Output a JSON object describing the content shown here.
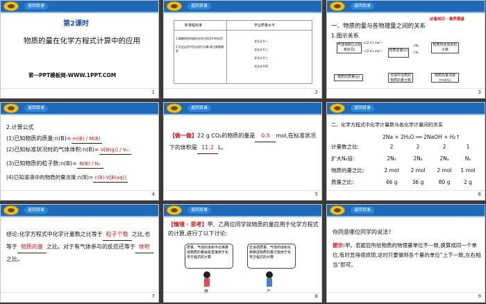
{
  "common": {
    "back_label": "返回目录"
  },
  "s1": {
    "lesson": "第2课时",
    "title": "物质的量在化学方程式计算中的应用",
    "site": "第一PPT模板网-WWW.1PPT.COM",
    "num": "1"
  },
  "s2": {
    "col1": "新课程标准",
    "col2": "学业质量水平",
    "req1": "1.掌握物质的量在化学方程式中的应用",
    "req2": "2.学会运用守恒法进行计算,建立解题模型",
    "levels": [
      "学业水平一",
      "学业水平二",
      "学业水平三",
      "学业水平四"
    ],
    "num": "2"
  },
  "s3": {
    "banner": "必备知识 · 素养奠基",
    "h1": "一、物质的量与各物理量之间的关系",
    "h2": "1.图示关系",
    "center": "物质的量(n)",
    "gas": "气体体积(L)(标准状况)",
    "particles": "物质所含有的粒子数",
    "mass": "物质的质量(g)",
    "conc": "物质的量浓度(mol/L)",
    "solute": "溶液中溶质的物质的量分数",
    "label_vm1": "×22.4 L·mol⁻¹",
    "label_vm2": "÷22.4 L·mol⁻¹",
    "label_na1": "×Nₐ",
    "label_na2": "÷Nₐ",
    "num": "3"
  },
  "s4": {
    "h": "2.计算公式",
    "l1": "(1)已知物质的质量:n(B)=",
    "l1a": "m(B) / M(B)",
    "l2": "(2)已知标准状况时的气体体积:n(B)=",
    "l2a": "V[B(g)] / Vₘ",
    "l3": "(3)已知物质的粒子数:n(B)=",
    "l3a": "N(B) / Nₐ",
    "l4": "(4)已知溶液中的物质的量浓度:n(B)=",
    "l4a": "c(B)·V[B(aq)]",
    "num": "4"
  },
  "s5": {
    "tag": "【做一做】",
    "t1": "22 g CO₂的物质的量是",
    "a1": "0.5",
    "t2": "mol,在标准状况下的体积是",
    "a2": "11.2",
    "t3": "L。",
    "num": "5"
  },
  "s6": {
    "h": "二、化学方程式中化学计量数与各化学计量间的关系",
    "eq": "2Na + 2H₂O ══ 2NaOH + H₂↑",
    "rows": [
      {
        "label": "计量数之比:",
        "vals": [
          "2",
          "2",
          "2",
          "1"
        ]
      },
      {
        "label": "扩大Nₐ倍:",
        "vals": [
          "2Nₐ",
          "2Nₐ",
          "2Nₐ",
          "Nₐ"
        ]
      },
      {
        "label": "物质的量之比:",
        "vals": [
          "2 mol",
          "2 mol",
          "2 mol",
          "1 mol"
        ]
      },
      {
        "label": "质量之比:",
        "vals": [
          "46 g",
          "36 g",
          "80 g",
          "2 g"
        ]
      }
    ],
    "num": "6"
  },
  "s7": {
    "t1": "结论:化学方程式中化学计量数之比等于",
    "a1": "粒子个数",
    "t2": "之比,也等于",
    "a2": "物质的量",
    "t3": "之比。对于有气体参与的反应还等于",
    "a3": "体积",
    "t4": "之比。",
    "num": "7"
  },
  "s8": {
    "tag": "【情境 · 思考】",
    "text": "甲、乙两位同学就物质的量应用于化学方程式的计算,进行了以下讨论:",
    "b1": "质量、气体的体积不必换算成物质的量就能直接用于化学方程式的计算",
    "b2": "应该把质量、气体的体积先换算成物质的量才能用于化学方程式的计算",
    "k1": "甲",
    "k2": "乙",
    "num": "8"
  },
  "s9": {
    "q": "你同意哪位同学的说法?",
    "tip": "提示:",
    "ans": "甲。若题目所给物质的物理量单位不一致,换算成同一个单位,有时显得很烦琐,这时只要做到各个量的单位“上下一致,左右相当”即可。",
    "num": "9"
  }
}
